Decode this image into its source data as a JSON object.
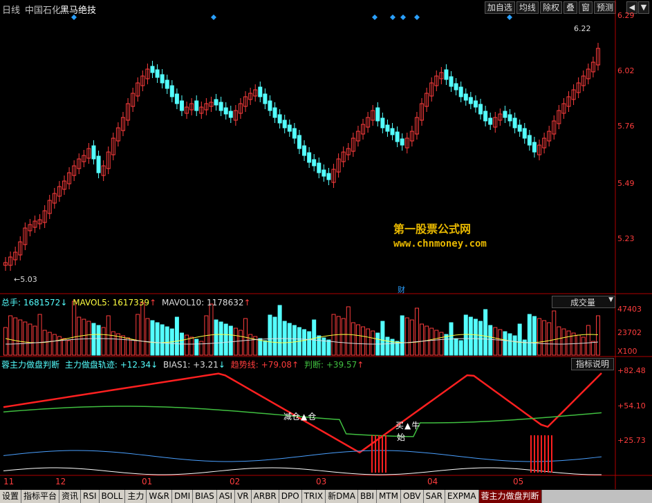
{
  "header": {
    "period": "日线",
    "stock": "中国石化",
    "indicator": "黑马绝技",
    "buttons": [
      "加自选",
      "均线",
      "除权",
      "叠",
      "窗",
      "预测"
    ],
    "nav": [
      "◀",
      "▼"
    ]
  },
  "price_axis": [
    "6.29",
    "6.02",
    "5.76",
    "5.49",
    "5.23"
  ],
  "price_marks": {
    "high": "6.22",
    "low": "5.03",
    "event": "财"
  },
  "watermark": {
    "cn": "第一股票公式网",
    "url": "www.chnmoney.com"
  },
  "volume": {
    "label_total": "总手: ",
    "total": "1681572",
    "mavol5_label": "MAVOL5: ",
    "mavol5": "1617339",
    "mavol10_label": "MAVOL10: ",
    "mavol10": "1178632",
    "arrow_down": "↓",
    "arrow_up": "↑",
    "selector": "成交量",
    "axis": [
      "47403",
      "23702",
      "X100"
    ]
  },
  "indicator": {
    "name": "蓉主力做盘判断",
    "track_label": "主力做盘轨迹: ",
    "track": "+12.34",
    "bias_label": "BIAS1: ",
    "bias": "+3.21",
    "trend_label": "趋势线: ",
    "trend": "+79.08",
    "judge_label": "判断: ",
    "judge": "+39.57",
    "help": "指标说明",
    "axis": [
      "+82.48",
      "+54.10",
      "+25.73"
    ],
    "sell_text": "减仓",
    "buy_text": "买",
    "bull_text": "牛",
    "start_text": "始",
    "pos_text": "仓"
  },
  "date_axis": [
    "11",
    "12",
    "01",
    "02",
    "03",
    "04",
    "05"
  ],
  "tabs": [
    "设置",
    "指标平台",
    "资讯",
    "RSI",
    "BOLL",
    "主力",
    "W&R",
    "DMI",
    "BIAS",
    "ASI",
    "VR",
    "ARBR",
    "DPO",
    "TRIX",
    "新DMA",
    "BBI",
    "MTM",
    "OBV",
    "SAR",
    "EXPMA",
    "蓉主力做盘判断"
  ],
  "colors": {
    "up": "#ff3d3d",
    "down": "#54ffff",
    "trend": "#ff2020",
    "judge": "#40c040",
    "track": "#4aa0ff",
    "bias": "#ffffff",
    "marker": "#2aa0ff"
  }
}
